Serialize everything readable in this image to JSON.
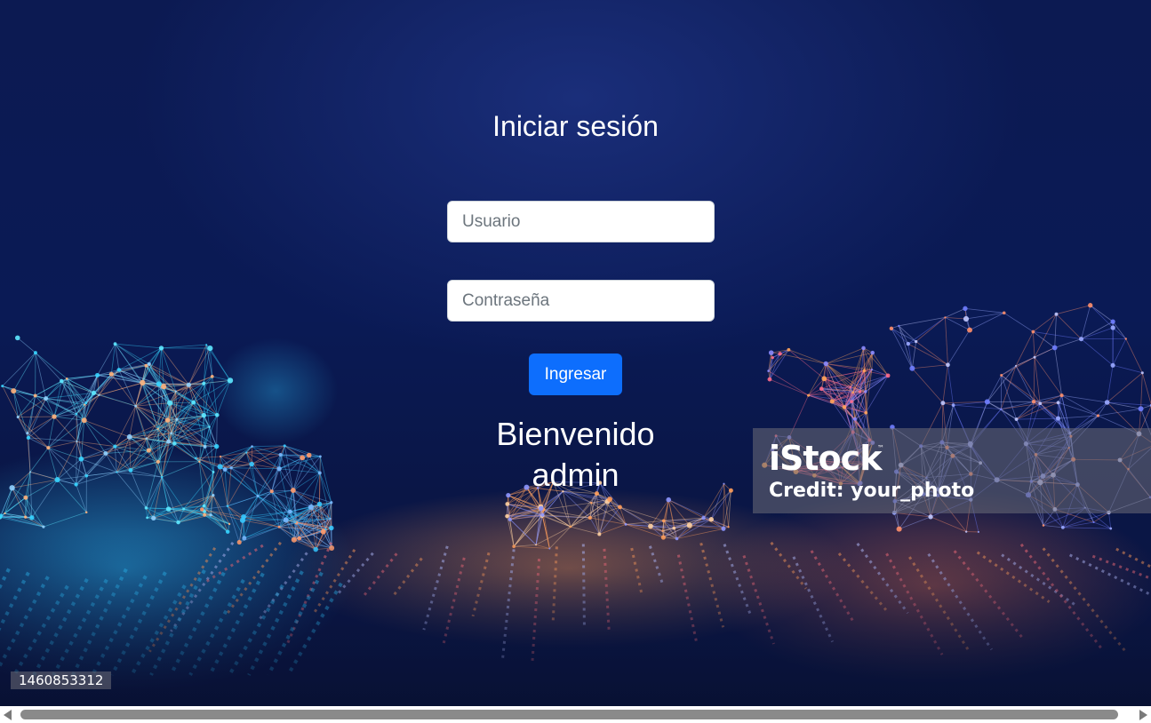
{
  "login": {
    "title": "Iniciar sesión",
    "username_placeholder": "Usuario",
    "username_value": "",
    "password_placeholder": "Contraseña",
    "password_value": "",
    "submit_label": "Ingresar"
  },
  "welcome": {
    "line1": "Bienvenido",
    "line2": "admin"
  },
  "watermark": {
    "brand": "iStock",
    "trademark": "™",
    "credit": "Credit: your_photo",
    "image_number": "1460853312"
  },
  "icons": {
    "scroll_left": "chevron-left-icon",
    "scroll_right": "chevron-right-icon"
  },
  "colors": {
    "background": "#0c1a52",
    "button": "#0d6efd",
    "text": "#ffffff"
  }
}
